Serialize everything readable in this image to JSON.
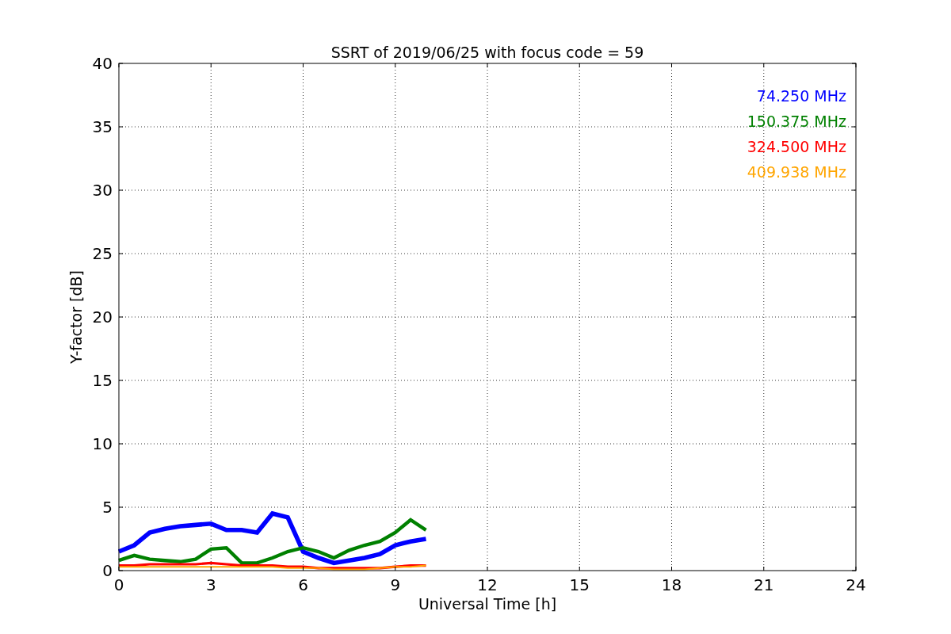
{
  "chart_data": {
    "type": "line",
    "title": "SSRT of 2019/06/25 with focus code = 59",
    "xlabel": "Universal Time [h]",
    "ylabel": "Y-factor [dB]",
    "x": [
      0,
      0.5,
      1,
      1.5,
      2,
      2.5,
      3,
      3.5,
      4,
      4.5,
      5,
      5.5,
      6,
      6.5,
      7,
      7.5,
      8,
      8.5,
      9,
      9.5,
      10
    ],
    "series": [
      {
        "name": "74.250 MHz",
        "color": "#0000ff",
        "values": [
          1.5,
          2.0,
          3.0,
          3.3,
          3.5,
          3.6,
          3.7,
          3.2,
          3.2,
          3.0,
          4.5,
          4.2,
          1.5,
          1.0,
          0.6,
          0.8,
          1.0,
          1.3,
          2.0,
          2.3,
          2.5
        ]
      },
      {
        "name": "150.375 MHz",
        "color": "#008000",
        "values": [
          0.8,
          1.2,
          0.9,
          0.8,
          0.7,
          0.9,
          1.7,
          1.8,
          0.6,
          0.6,
          1.0,
          1.5,
          1.8,
          1.5,
          1.0,
          1.6,
          2.0,
          2.3,
          3.0,
          4.0,
          3.2
        ]
      },
      {
        "name": "324.500 MHz",
        "color": "#ff0000",
        "values": [
          0.4,
          0.4,
          0.5,
          0.5,
          0.5,
          0.5,
          0.6,
          0.5,
          0.4,
          0.4,
          0.4,
          0.3,
          0.3,
          0.2,
          0.2,
          0.2,
          0.2,
          0.2,
          0.3,
          0.4,
          0.4
        ]
      },
      {
        "name": "409.938 MHz",
        "color": "#ffa500",
        "values": [
          0.3,
          0.3,
          0.3,
          0.3,
          0.3,
          0.3,
          0.3,
          0.3,
          0.3,
          0.3,
          0.3,
          0.2,
          0.2,
          0.2,
          0.1,
          0.1,
          0.1,
          0.2,
          0.3,
          0.3,
          0.4
        ]
      }
    ],
    "xlim": [
      0,
      24
    ],
    "ylim": [
      0,
      40
    ],
    "xticks": [
      0,
      3,
      6,
      9,
      12,
      15,
      18,
      21,
      24
    ],
    "yticks": [
      0,
      5,
      10,
      15,
      20,
      25,
      30,
      35,
      40
    ],
    "grid": true
  }
}
